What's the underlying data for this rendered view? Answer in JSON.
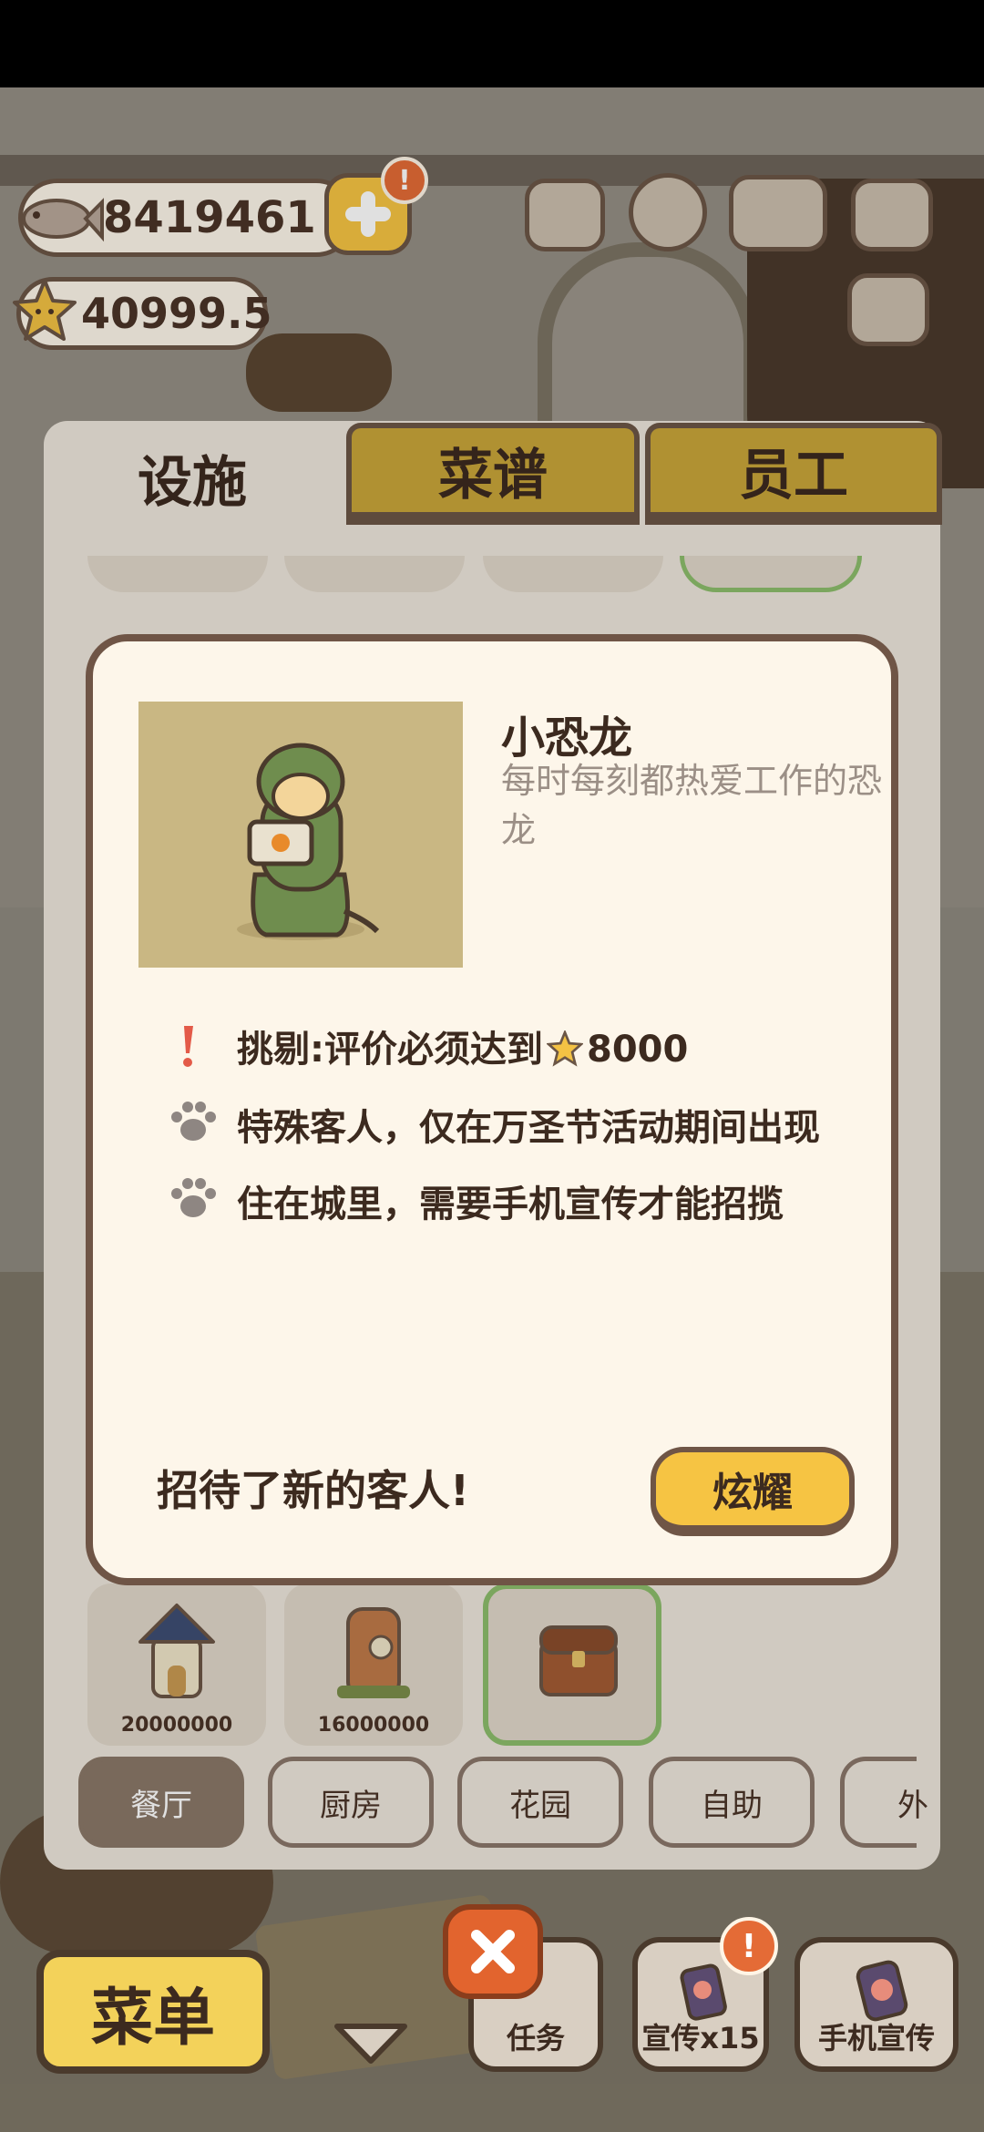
{
  "currency": {
    "fish": "8419461",
    "stars": "40999.5"
  },
  "alerts": {
    "topup": "!",
    "promo": "!"
  },
  "tabs": [
    {
      "label": "设施",
      "active": true
    },
    {
      "label": "菜谱",
      "active": false
    },
    {
      "label": "员工",
      "active": false
    }
  ],
  "dialog": {
    "name": "小恐龙",
    "description": "每时每刻都热爱工作的恐龙",
    "traits": [
      {
        "icon": "exclamation-icon",
        "prefix": "挑剔:评价必须达到",
        "value": "8000"
      },
      {
        "icon": "paw-icon",
        "text": "特殊客人，仅在万圣节活动期间出现"
      },
      {
        "icon": "paw-icon",
        "text": "住在城里，需要手机宣传才能招揽"
      }
    ],
    "footer_text": "招待了新的客人!",
    "show_button": "炫耀"
  },
  "items": [
    {
      "price": "20000000"
    },
    {
      "price": "16000000"
    }
  ],
  "categories": [
    "餐厅",
    "厨房",
    "花园",
    "自助",
    "外"
  ],
  "bottom_bar": {
    "menu": "菜单",
    "tasks": "任务",
    "promo_x15": "宣传x15",
    "phone_promo": "手机宣传"
  },
  "colors": {
    "accent_yellow": "#f6c443",
    "border_brown": "#6f5546",
    "dialog_bg": "#fdf6ea",
    "alert_orange": "#e46b36"
  }
}
